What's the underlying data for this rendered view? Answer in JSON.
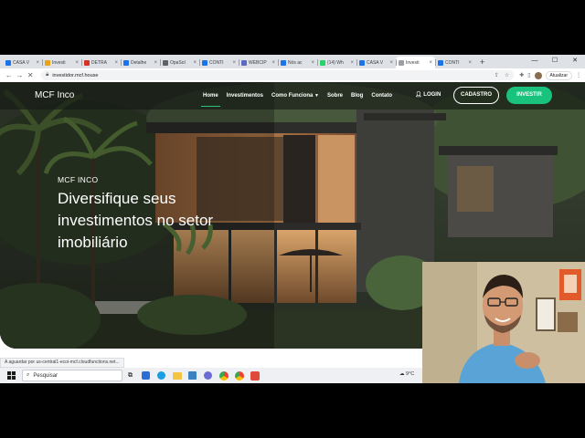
{
  "browser": {
    "tabs": [
      {
        "label": "CASA V",
        "color": "#1a73e8"
      },
      {
        "label": "Investi",
        "color": "#e8a317"
      },
      {
        "label": "DETRA",
        "color": "#d93025"
      },
      {
        "label": "Detalhe",
        "color": "#1a73e8"
      },
      {
        "label": "OpaSol",
        "color": "#5f6368"
      },
      {
        "label": "CONTI",
        "color": "#1a73e8"
      },
      {
        "label": "WEBCIP",
        "color": "#5c6bc0"
      },
      {
        "label": "Nós ac",
        "color": "#1a73e8"
      },
      {
        "label": "(14) Wh",
        "color": "#25d366"
      },
      {
        "label": "CASA V",
        "color": "#1a73e8"
      },
      {
        "label": "Investi",
        "color": "#9aa0a6",
        "active": true
      },
      {
        "label": "CONTI",
        "color": "#1a73e8"
      }
    ],
    "url": "investidor.mcf.house",
    "update_label": "Atualizar",
    "status_text": "A aguardar por us-central1-ecoi-mcf.cloudfunctions.net..."
  },
  "site": {
    "logo": "MCF Inco",
    "nav": [
      {
        "label": "Home",
        "active": true
      },
      {
        "label": "Investimentos"
      },
      {
        "label": "Como Funciona"
      },
      {
        "label": "Sobre"
      },
      {
        "label": "Blog"
      },
      {
        "label": "Contato"
      }
    ],
    "login_label": "LOGIN",
    "cadastro_label": "CADASTRO",
    "investir_label": "INVESTIR",
    "hero": {
      "eyebrow": "MCF INCO",
      "headline": "Diversifique seus investimentos no setor imobiliário"
    }
  },
  "taskbar": {
    "search_placeholder": "Pesquisar",
    "weather": "9°C"
  },
  "colors": {
    "accent": "#19c37d",
    "nav_bg": "#141814"
  }
}
